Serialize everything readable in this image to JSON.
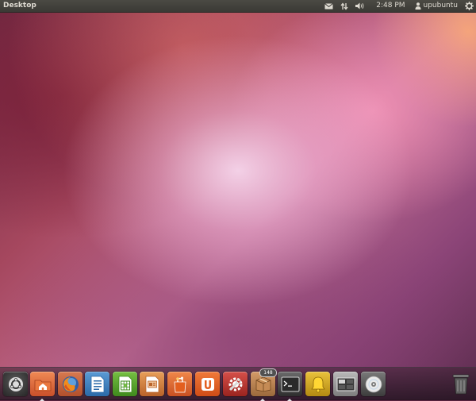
{
  "top_panel": {
    "title": "Desktop",
    "clock": "2:48 PM",
    "user": "upubuntu",
    "indicator_icons": [
      "mail-icon",
      "network-icon",
      "volume-icon",
      "user-icon",
      "gear-icon"
    ]
  },
  "launcher": {
    "items": [
      {
        "name": "ubuntu-button",
        "icon": "ubuntu-logo-icon",
        "running": false
      },
      {
        "name": "home-folder",
        "icon": "home-folder-icon",
        "running": true
      },
      {
        "name": "firefox",
        "icon": "firefox-icon",
        "running": false
      },
      {
        "name": "libreoffice-writer",
        "icon": "writer-icon",
        "running": false
      },
      {
        "name": "libreoffice-calc",
        "icon": "calc-icon",
        "running": false
      },
      {
        "name": "libreoffice-impress",
        "icon": "impress-icon",
        "running": false
      },
      {
        "name": "software-center",
        "icon": "shopping-bag-icon",
        "running": false
      },
      {
        "name": "ubuntu-one",
        "icon": "ubuntu-one-icon",
        "running": false
      },
      {
        "name": "system-settings",
        "icon": "settings-wrench-icon",
        "running": false
      },
      {
        "name": "update-manager",
        "icon": "package-icon",
        "badge": "148",
        "running": true
      },
      {
        "name": "terminal",
        "icon": "terminal-icon",
        "running": true
      },
      {
        "name": "notifications",
        "icon": "bell-icon",
        "running": false
      },
      {
        "name": "workspace-switcher",
        "icon": "workspace-icon",
        "running": false
      },
      {
        "name": "cd-drive",
        "icon": "disc-icon",
        "running": false
      },
      {
        "name": "trash",
        "icon": "trash-icon",
        "running": false
      }
    ]
  },
  "colors": {
    "panel_bg": "#3c3b37",
    "panel_text": "#dfdbd2",
    "wallpaper_accent": "#c46f95",
    "ubuntu_orange": "#e85d20"
  }
}
